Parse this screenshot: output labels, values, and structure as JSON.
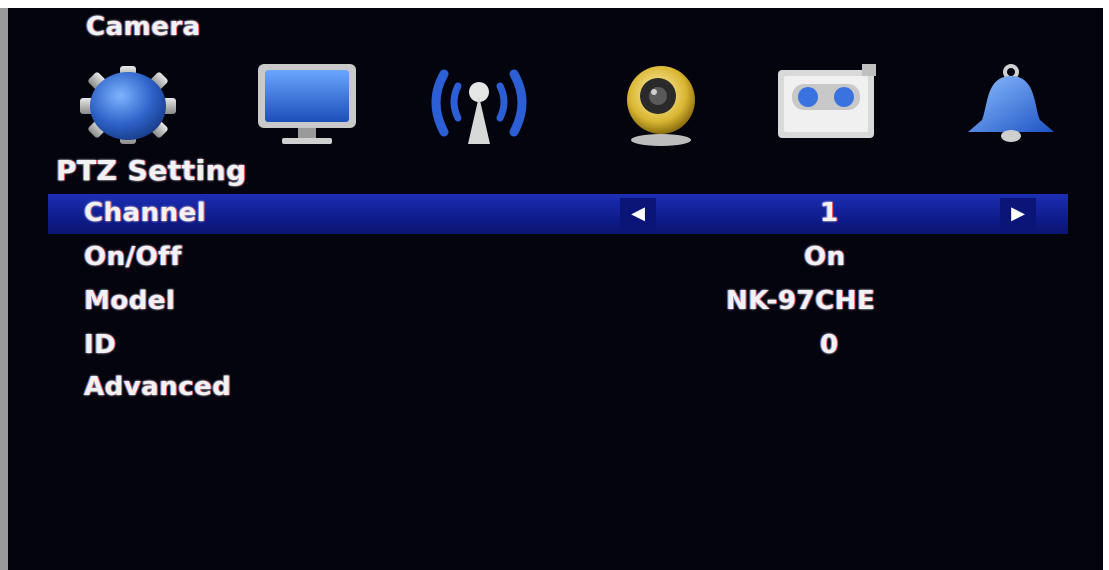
{
  "window": {
    "title": "Camera"
  },
  "icons": [
    {
      "name": "system-gear-icon"
    },
    {
      "name": "display-monitor-icon"
    },
    {
      "name": "network-antenna-icon"
    },
    {
      "name": "webcam-icon"
    },
    {
      "name": "recording-tape-icon"
    },
    {
      "name": "alarm-bell-icon"
    }
  ],
  "section": {
    "title": "PTZ Setting"
  },
  "settings": {
    "channel": {
      "label": "Channel",
      "value": "1",
      "left_arrow": "◀",
      "right_arrow": "▶"
    },
    "onoff": {
      "label": "On/Off",
      "value": "On"
    },
    "model": {
      "label": "Model",
      "value": "NK-97CHE"
    },
    "id": {
      "label": "ID",
      "value": "0"
    },
    "advanced": {
      "label": "Advanced"
    }
  },
  "colors": {
    "background": "#04040e",
    "highlight": "#1424a0",
    "text": "#f2f2f2"
  }
}
